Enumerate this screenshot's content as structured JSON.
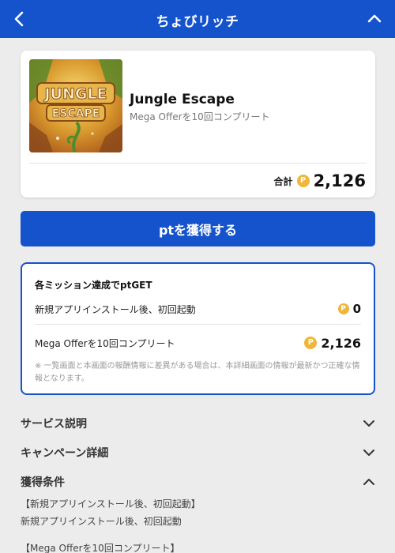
{
  "header": {
    "title": "ちょびリッチ",
    "back_icon": "chevron-left-icon",
    "collapse_icon": "chevron-up-icon",
    "background": "#1453cc"
  },
  "offer": {
    "thumbnail_line1": "JUNGLE",
    "thumbnail_line2": "ESCAPE",
    "app_name": "Jungle Escape",
    "subtitle": "Mega Offerを10回コンプリート",
    "total_label": "合計",
    "coin_symbol": "P",
    "total_value": "2,126"
  },
  "cta": {
    "label": "ptを獲得する",
    "color": "#1453cc"
  },
  "missions": {
    "title": "各ミッション達成でptGET",
    "items": [
      {
        "label": "新規アプリインストール後、初回起動",
        "points": "0"
      },
      {
        "label": "Mega Offerを10回コンプリート",
        "points": "2,126"
      }
    ],
    "note": "※ 一覧画面と本画面の報酬情報に差異がある場合は、本詳細画面の情報が最新かつ正確な情報となります。",
    "coin_color": "#f1b53a"
  },
  "sections": [
    {
      "label": "サービス説明",
      "expanded": false
    },
    {
      "label": "キャンペーン詳細",
      "expanded": false
    },
    {
      "label": "獲得条件",
      "expanded": true
    }
  ],
  "conditions": {
    "heading1": "【新規アプリインストール後、初回起動】",
    "text1": "新規アプリインストール後、初回起動",
    "heading2": "【Mega Offerを10回コンプリート】"
  }
}
